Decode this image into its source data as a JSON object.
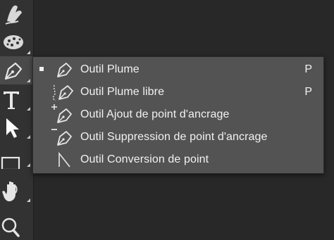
{
  "toolbar": {
    "tools": [
      {
        "name": "smudge-tool",
        "icon": "finger-smudge-icon"
      },
      {
        "name": "sponge-tool",
        "icon": "sponge-icon"
      },
      {
        "name": "pen-tool",
        "icon": "pen-nib-icon",
        "active": true
      },
      {
        "name": "type-tool",
        "icon": "type-T-icon",
        "glyph": "T"
      },
      {
        "name": "path-selection-tool",
        "icon": "arrow-pointer-icon"
      },
      {
        "name": "rectangle-tool",
        "icon": "rectangle-icon"
      },
      {
        "name": "hand-tool",
        "icon": "hand-icon"
      },
      {
        "name": "zoom-tool",
        "icon": "magnifier-icon"
      }
    ]
  },
  "flyout": {
    "items": [
      {
        "label": "Outil Plume",
        "shortcut": "P",
        "selected": true,
        "icon": "pen-nib-icon"
      },
      {
        "label": "Outil Plume libre",
        "shortcut": "P",
        "selected": false,
        "icon": "freeform-pen-icon"
      },
      {
        "label": "Outil Ajout de point d'ancrage",
        "shortcut": "",
        "selected": false,
        "icon": "add-anchor-point-icon"
      },
      {
        "label": "Outil Suppression de point d'ancrage",
        "shortcut": "",
        "selected": false,
        "icon": "delete-anchor-point-icon"
      },
      {
        "label": "Outil Conversion de point",
        "shortcut": "",
        "selected": false,
        "icon": "convert-point-icon"
      }
    ]
  },
  "colors": {
    "canvas": "#282828",
    "toolbar": "#323232",
    "flyout": "#535353",
    "text": "#f2f2f2"
  }
}
